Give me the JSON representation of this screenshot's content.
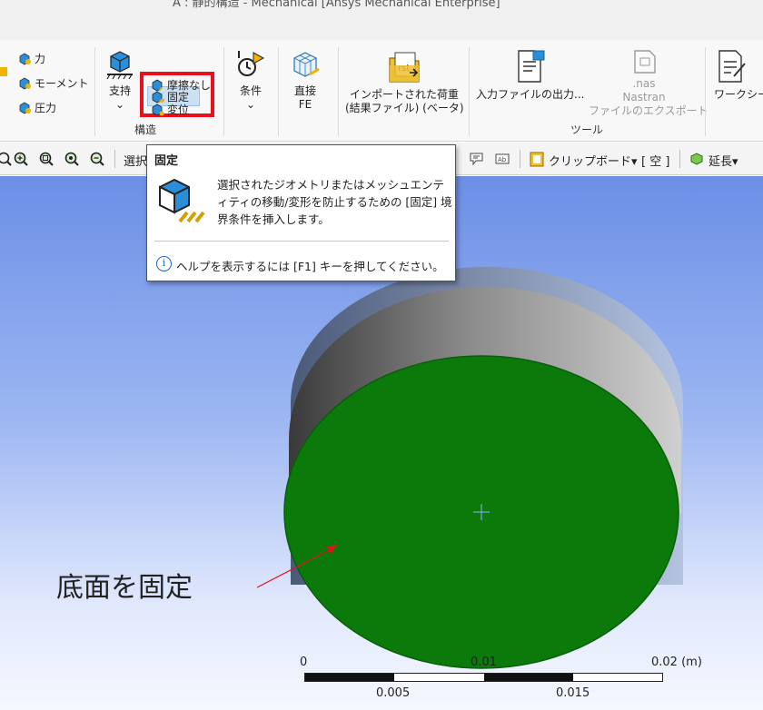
{
  "window": {
    "title": "A : 静的構造 - Mechanical [Ansys Mechanical Enterprise]"
  },
  "ribbon": {
    "loads": {
      "force": "力",
      "moment": "モーメント",
      "pressure": "圧力"
    },
    "structural": {
      "support": "支持",
      "fixed": "固定",
      "frictionless": "摩擦なし",
      "displacement": "変位",
      "group_label": "構造"
    },
    "conditions": "条件",
    "direct_fe": {
      "line1": "直接",
      "line2": "FE"
    },
    "import_loads": {
      "line1": "インポートされた荷重",
      "line2": "(結果ファイル) (ベータ)"
    },
    "tools": {
      "input_file_output": "入力ファイルの出力...",
      "nastran_ext": ".nas",
      "nastran": "Nastran",
      "nastran_export": "ファイルのエクスポート",
      "group_label": "ツール"
    },
    "worksheet": "ワークシー"
  },
  "toolbar": {
    "select": "選択",
    "clipboard": "クリップボード",
    "empty": "[ 空 ]",
    "extend": "延長"
  },
  "tooltip": {
    "title": "固定",
    "body": "選択されたジオメトリまたはメッシュエンティティの移動/変形を防止するための [固定] 境界条件を挿入します。",
    "help": "ヘルプを表示するには [F1] キーを押してください。"
  },
  "viewport": {
    "annotation": "底面を固定",
    "scale": {
      "t0": "0",
      "t1": "0.01",
      "t2": "0.02 (m)",
      "b1": "0.005",
      "b2": "0.015"
    }
  },
  "colors": {
    "fixed_face": "#0b7a0b",
    "highlight": "#e8101a"
  }
}
